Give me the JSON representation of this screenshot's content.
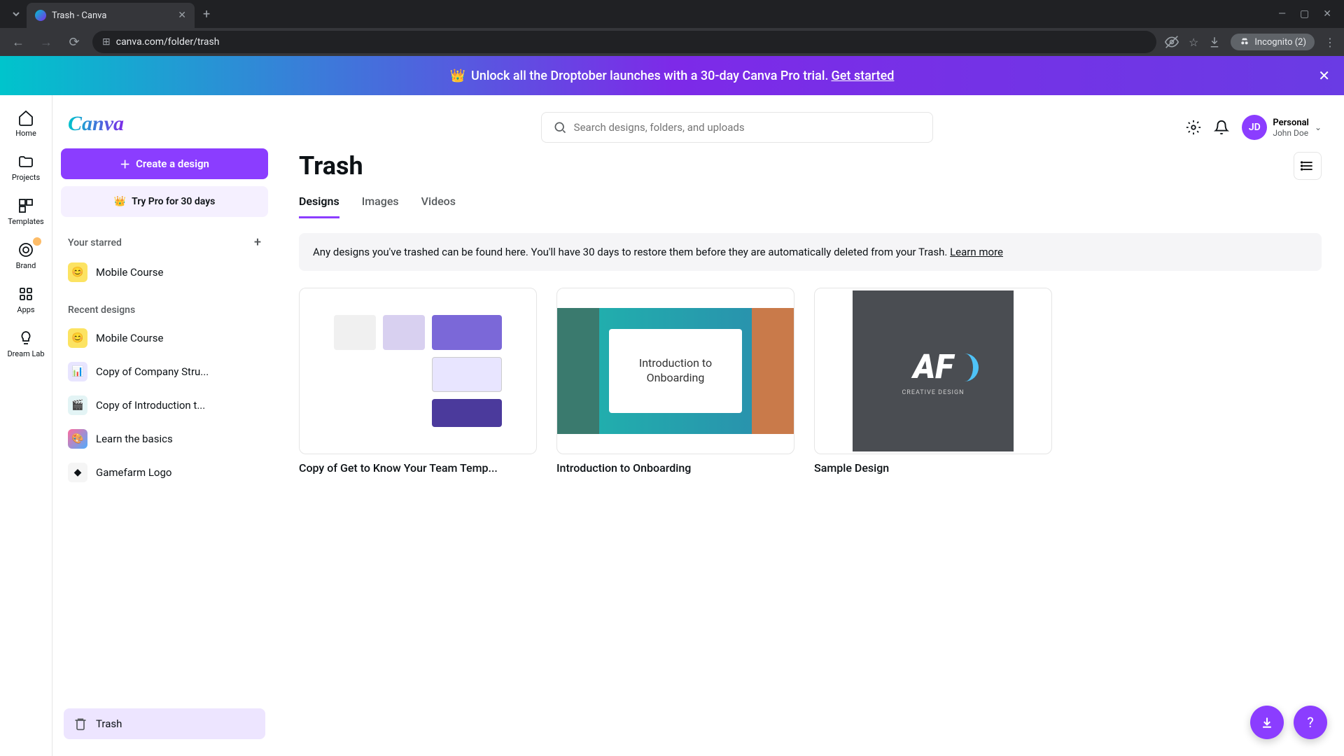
{
  "browser": {
    "tab_title": "Trash - Canva",
    "url": "canva.com/folder/trash",
    "incognito_label": "Incognito (2)"
  },
  "banner": {
    "text": "Unlock all the Droptober launches with a 30-day Canva Pro trial.",
    "cta": "Get started"
  },
  "rail": {
    "home": "Home",
    "projects": "Projects",
    "templates": "Templates",
    "brand": "Brand",
    "apps": "Apps",
    "dreamlab": "Dream Lab"
  },
  "sidebar": {
    "logo": "Canva",
    "create_label": "Create a design",
    "try_pro_label": "Try Pro for 30 days",
    "starred_header": "Your starred",
    "starred_items": [
      "Mobile Course"
    ],
    "recent_header": "Recent designs",
    "recent_items": [
      "Mobile Course",
      "Copy of Company Stru...",
      "Copy of Introduction t...",
      "Learn the basics",
      "Gamefarm Logo"
    ],
    "trash_label": "Trash"
  },
  "topbar": {
    "search_placeholder": "Search designs, folders, and uploads",
    "avatar_initials": "JD",
    "profile_name": "Personal",
    "profile_sub": "John Doe"
  },
  "page": {
    "title": "Trash",
    "tabs": {
      "designs": "Designs",
      "images": "Images",
      "videos": "Videos"
    },
    "info_text": "Any designs you've trashed can be found here. You'll have 30 days to restore them before they are automatically deleted from your Trash.",
    "info_link": "Learn more"
  },
  "cards": [
    {
      "title": "Copy of Get to Know Your Team Temp..."
    },
    {
      "title": "Introduction to Onboarding"
    },
    {
      "title": "Sample Design"
    }
  ],
  "thumb2": {
    "line1": "Introduction to",
    "line2": "Onboarding"
  },
  "thumb3": {
    "logo_text": "AF",
    "tagline": "CREATIVE DESIGN"
  }
}
